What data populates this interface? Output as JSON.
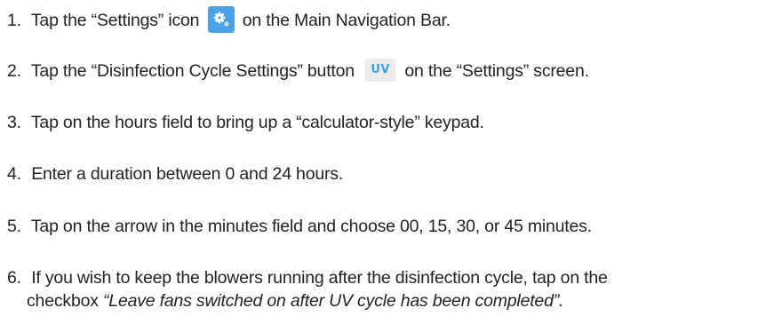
{
  "steps": [
    {
      "num": "1.",
      "before": "Tap the “Settings” icon",
      "after": "on the Main Navigation Bar.",
      "icon": "settings-gear-icon"
    },
    {
      "num": "2.",
      "before": "Tap the “Disinfection Cycle Settings” button",
      "after": "on the “Settings” screen.",
      "icon": "uv-icon",
      "icon_label": "UV"
    },
    {
      "num": "3.",
      "text": "Tap on the hours field to bring up a “calculator-style” keypad."
    },
    {
      "num": "4.",
      "text": "Enter a duration between 0 and 24 hours."
    },
    {
      "num": "5.",
      "text": "Tap on the arrow in the minutes field and choose 00, 15, 30, or 45 minutes."
    },
    {
      "num": "6.",
      "text": "If you wish to keep the blowers running after the disinfection cycle, tap on the",
      "continuation_prefix": "checkbox",
      "continuation_italic": "“Leave fans switched on after UV cycle has been completed”."
    }
  ],
  "colors": {
    "text": "#222222",
    "settings_icon_bg": "#4aa3e6",
    "uv_icon_bg": "#ececec",
    "uv_icon_text": "#3aa0e8"
  }
}
